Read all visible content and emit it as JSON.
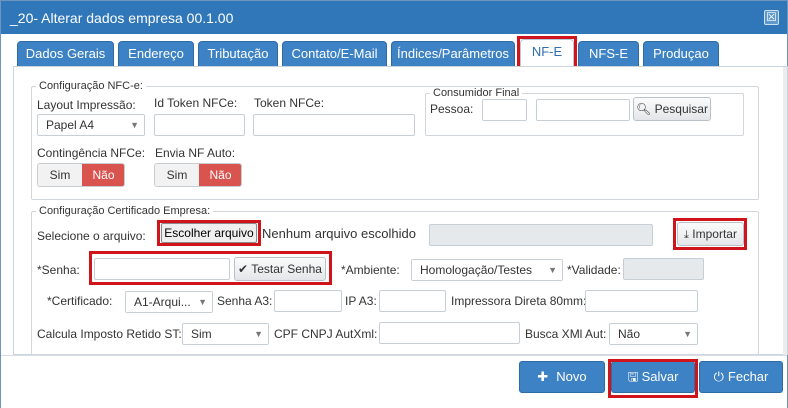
{
  "window": {
    "title": "_20- Alterar dados empresa 00.1.00",
    "close_glyph": "☒"
  },
  "tabs": [
    {
      "label": "Dados Gerais"
    },
    {
      "label": "Endereço"
    },
    {
      "label": "Tributação"
    },
    {
      "label": "Contato/E-Mail"
    },
    {
      "label": "Índices/Parâmetros"
    },
    {
      "label": "NF-E"
    },
    {
      "label": "NFS-E"
    },
    {
      "label": "Produçao"
    }
  ],
  "active_tab": "NF-E",
  "nfce": {
    "legend": "Configuração NFC-e:",
    "layout_label": "Layout Impressão:",
    "layout_value": "Papel A4",
    "id_token_label": "Id Token NFCe:",
    "id_token_value": "",
    "token_label": "Token NFCe:",
    "token_value": "",
    "contingencia_label": "Contingência NFCe:",
    "envia_label": "Envia NF Auto:",
    "sim": "Sim",
    "nao": "Não",
    "consumidor": {
      "legend": "Consumidor Final",
      "pessoa_label": "Pessoa:",
      "pesquisar_label": "Pesquisar"
    }
  },
  "cert": {
    "legend": "Configuração Certificado Empresa:",
    "selecione_label": "Selecione o arquivo:",
    "escolher_label": "Escolher arquivo",
    "nenhum_label": "Nenhum arquivo escolhido",
    "importar_label": "Importar",
    "senha_label": "*Senha:",
    "testar_label": "Testar Senha",
    "ambiente_label": "*Ambiente:",
    "ambiente_value": "Homologação/Testes",
    "validade_label": "*Validade:",
    "certificado_label": "*Certificado:",
    "certificado_value": "A1-Arqui...",
    "senha_a3_label": "Senha A3:",
    "ip_a3_label": "IP A3:",
    "impressora_label": "Impressora Direta 80mm:",
    "calcula_label": "Calcula Imposto Retido ST:",
    "calcula_value": "Sim",
    "cpf_label": "CPF CNPJ AutXml:",
    "busca_label": "Busca XMl Aut:",
    "busca_value": "Não"
  },
  "footer": {
    "novo_label": "Novo",
    "salvar_label": "Salvar",
    "fechar_label": "Fechar"
  },
  "colors": {
    "accent": "#3d82c4",
    "titlebar": "#2f77b9",
    "danger": "#d9534f",
    "highlight": "#d0141b"
  }
}
